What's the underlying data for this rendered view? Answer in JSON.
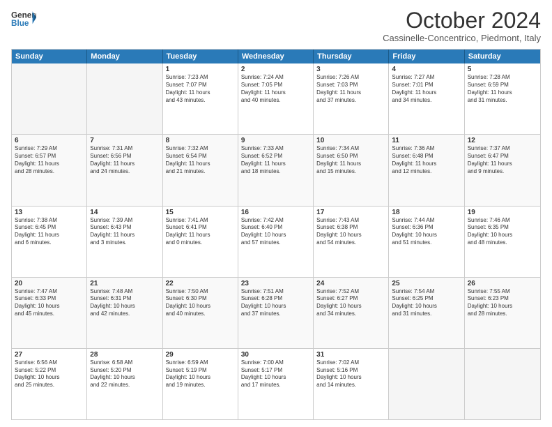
{
  "logo": {
    "line1": "General",
    "line2": "Blue"
  },
  "title": "October 2024",
  "subtitle": "Cassinelle-Concentrico, Piedmont, Italy",
  "header_days": [
    "Sunday",
    "Monday",
    "Tuesday",
    "Wednesday",
    "Thursday",
    "Friday",
    "Saturday"
  ],
  "weeks": [
    [
      {
        "day": "",
        "lines": [],
        "empty": true
      },
      {
        "day": "",
        "lines": [],
        "empty": true
      },
      {
        "day": "1",
        "lines": [
          "Sunrise: 7:23 AM",
          "Sunset: 7:07 PM",
          "Daylight: 11 hours",
          "and 43 minutes."
        ]
      },
      {
        "day": "2",
        "lines": [
          "Sunrise: 7:24 AM",
          "Sunset: 7:05 PM",
          "Daylight: 11 hours",
          "and 40 minutes."
        ]
      },
      {
        "day": "3",
        "lines": [
          "Sunrise: 7:26 AM",
          "Sunset: 7:03 PM",
          "Daylight: 11 hours",
          "and 37 minutes."
        ]
      },
      {
        "day": "4",
        "lines": [
          "Sunrise: 7:27 AM",
          "Sunset: 7:01 PM",
          "Daylight: 11 hours",
          "and 34 minutes."
        ]
      },
      {
        "day": "5",
        "lines": [
          "Sunrise: 7:28 AM",
          "Sunset: 6:59 PM",
          "Daylight: 11 hours",
          "and 31 minutes."
        ]
      }
    ],
    [
      {
        "day": "6",
        "lines": [
          "Sunrise: 7:29 AM",
          "Sunset: 6:57 PM",
          "Daylight: 11 hours",
          "and 28 minutes."
        ]
      },
      {
        "day": "7",
        "lines": [
          "Sunrise: 7:31 AM",
          "Sunset: 6:56 PM",
          "Daylight: 11 hours",
          "and 24 minutes."
        ]
      },
      {
        "day": "8",
        "lines": [
          "Sunrise: 7:32 AM",
          "Sunset: 6:54 PM",
          "Daylight: 11 hours",
          "and 21 minutes."
        ]
      },
      {
        "day": "9",
        "lines": [
          "Sunrise: 7:33 AM",
          "Sunset: 6:52 PM",
          "Daylight: 11 hours",
          "and 18 minutes."
        ]
      },
      {
        "day": "10",
        "lines": [
          "Sunrise: 7:34 AM",
          "Sunset: 6:50 PM",
          "Daylight: 11 hours",
          "and 15 minutes."
        ]
      },
      {
        "day": "11",
        "lines": [
          "Sunrise: 7:36 AM",
          "Sunset: 6:48 PM",
          "Daylight: 11 hours",
          "and 12 minutes."
        ]
      },
      {
        "day": "12",
        "lines": [
          "Sunrise: 7:37 AM",
          "Sunset: 6:47 PM",
          "Daylight: 11 hours",
          "and 9 minutes."
        ]
      }
    ],
    [
      {
        "day": "13",
        "lines": [
          "Sunrise: 7:38 AM",
          "Sunset: 6:45 PM",
          "Daylight: 11 hours",
          "and 6 minutes."
        ]
      },
      {
        "day": "14",
        "lines": [
          "Sunrise: 7:39 AM",
          "Sunset: 6:43 PM",
          "Daylight: 11 hours",
          "and 3 minutes."
        ]
      },
      {
        "day": "15",
        "lines": [
          "Sunrise: 7:41 AM",
          "Sunset: 6:41 PM",
          "Daylight: 11 hours",
          "and 0 minutes."
        ]
      },
      {
        "day": "16",
        "lines": [
          "Sunrise: 7:42 AM",
          "Sunset: 6:40 PM",
          "Daylight: 10 hours",
          "and 57 minutes."
        ]
      },
      {
        "day": "17",
        "lines": [
          "Sunrise: 7:43 AM",
          "Sunset: 6:38 PM",
          "Daylight: 10 hours",
          "and 54 minutes."
        ]
      },
      {
        "day": "18",
        "lines": [
          "Sunrise: 7:44 AM",
          "Sunset: 6:36 PM",
          "Daylight: 10 hours",
          "and 51 minutes."
        ]
      },
      {
        "day": "19",
        "lines": [
          "Sunrise: 7:46 AM",
          "Sunset: 6:35 PM",
          "Daylight: 10 hours",
          "and 48 minutes."
        ]
      }
    ],
    [
      {
        "day": "20",
        "lines": [
          "Sunrise: 7:47 AM",
          "Sunset: 6:33 PM",
          "Daylight: 10 hours",
          "and 45 minutes."
        ]
      },
      {
        "day": "21",
        "lines": [
          "Sunrise: 7:48 AM",
          "Sunset: 6:31 PM",
          "Daylight: 10 hours",
          "and 42 minutes."
        ]
      },
      {
        "day": "22",
        "lines": [
          "Sunrise: 7:50 AM",
          "Sunset: 6:30 PM",
          "Daylight: 10 hours",
          "and 40 minutes."
        ]
      },
      {
        "day": "23",
        "lines": [
          "Sunrise: 7:51 AM",
          "Sunset: 6:28 PM",
          "Daylight: 10 hours",
          "and 37 minutes."
        ]
      },
      {
        "day": "24",
        "lines": [
          "Sunrise: 7:52 AM",
          "Sunset: 6:27 PM",
          "Daylight: 10 hours",
          "and 34 minutes."
        ]
      },
      {
        "day": "25",
        "lines": [
          "Sunrise: 7:54 AM",
          "Sunset: 6:25 PM",
          "Daylight: 10 hours",
          "and 31 minutes."
        ]
      },
      {
        "day": "26",
        "lines": [
          "Sunrise: 7:55 AM",
          "Sunset: 6:23 PM",
          "Daylight: 10 hours",
          "and 28 minutes."
        ]
      }
    ],
    [
      {
        "day": "27",
        "lines": [
          "Sunrise: 6:56 AM",
          "Sunset: 5:22 PM",
          "Daylight: 10 hours",
          "and 25 minutes."
        ]
      },
      {
        "day": "28",
        "lines": [
          "Sunrise: 6:58 AM",
          "Sunset: 5:20 PM",
          "Daylight: 10 hours",
          "and 22 minutes."
        ]
      },
      {
        "day": "29",
        "lines": [
          "Sunrise: 6:59 AM",
          "Sunset: 5:19 PM",
          "Daylight: 10 hours",
          "and 19 minutes."
        ]
      },
      {
        "day": "30",
        "lines": [
          "Sunrise: 7:00 AM",
          "Sunset: 5:17 PM",
          "Daylight: 10 hours",
          "and 17 minutes."
        ]
      },
      {
        "day": "31",
        "lines": [
          "Sunrise: 7:02 AM",
          "Sunset: 5:16 PM",
          "Daylight: 10 hours",
          "and 14 minutes."
        ]
      },
      {
        "day": "",
        "lines": [],
        "empty": true
      },
      {
        "day": "",
        "lines": [],
        "empty": true
      }
    ]
  ]
}
